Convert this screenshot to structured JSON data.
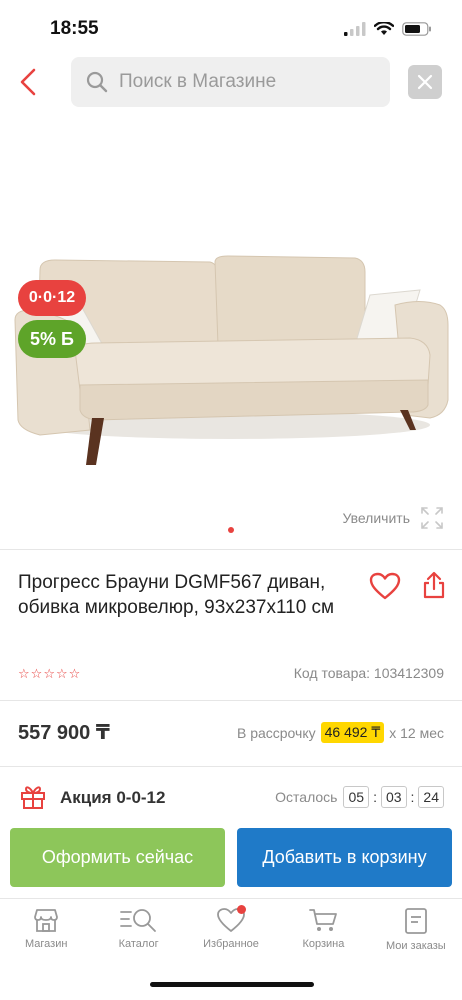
{
  "status_bar": {
    "time": "18:55"
  },
  "search": {
    "placeholder": "Поиск в Магазине"
  },
  "hero": {
    "badge_sale": "0·0·12",
    "badge_bonus": "5% Б",
    "zoom_label": "Увеличить"
  },
  "product": {
    "title": "Прогресс Брауни DGMF567 диван, обивка микровелюр, 93x237x110 см",
    "sku_text": "Код товара: 103412309",
    "rating_stars": 5,
    "price": "557 900 ₸",
    "installment": {
      "prefix": "В рассрочку",
      "amount": "46 492 ₸",
      "suffix": "x 12 мес"
    }
  },
  "promo": {
    "label": "Акция 0-0-12",
    "countdown_label": "Осталось",
    "hours": "05",
    "minutes": "03",
    "seconds": "24"
  },
  "actions": {
    "buy_now": "Оформить сейчас",
    "add_to_cart": "Добавить в корзину"
  },
  "tabbar": {
    "items": [
      {
        "label": "Магазин",
        "icon": "store-icon"
      },
      {
        "label": "Каталог",
        "icon": "catalog-search-icon"
      },
      {
        "label": "Избранное",
        "icon": "heart-icon"
      },
      {
        "label": "Корзина",
        "icon": "cart-icon"
      },
      {
        "label": "Мои заказы",
        "icon": "orders-icon"
      }
    ]
  },
  "colors": {
    "accent_red": "#e8423f",
    "bonus_green": "#5ea429",
    "buy_green": "#8dc65a",
    "cart_blue": "#1f7ac8",
    "installment_yellow": "#ffd700"
  }
}
